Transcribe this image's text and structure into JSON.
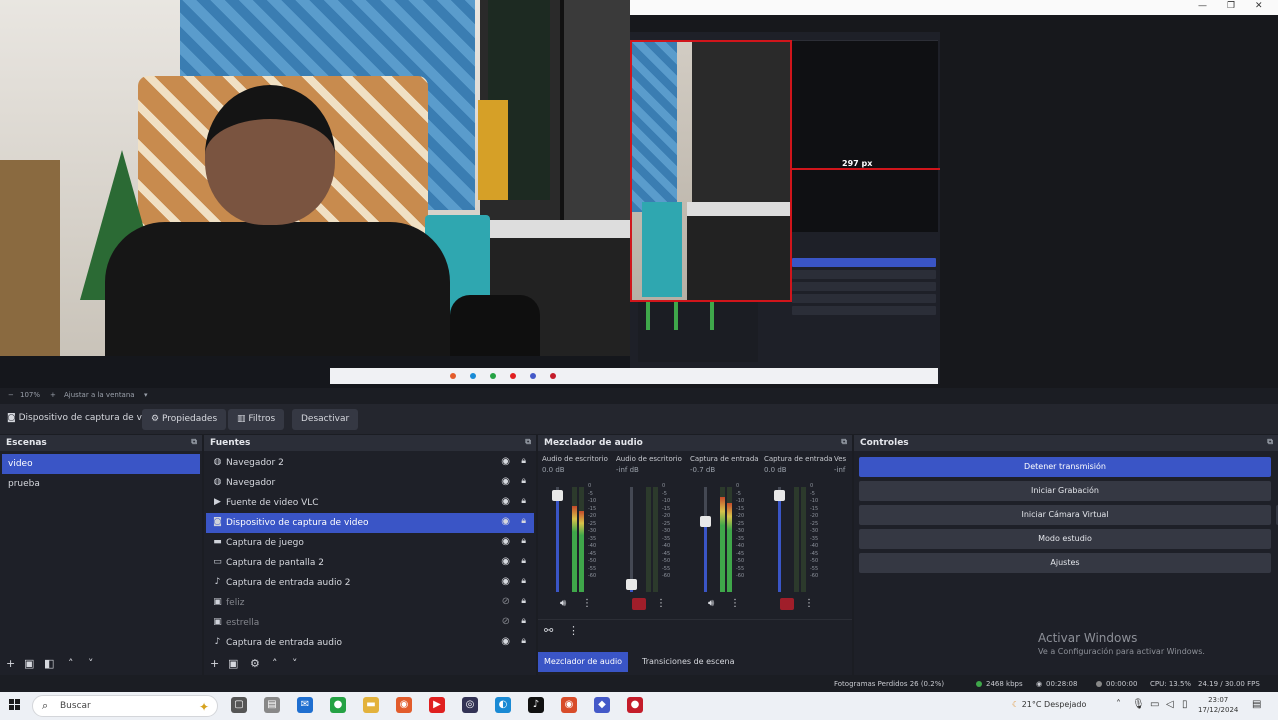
{
  "preview": {
    "measure_label": "297 px"
  },
  "zoom_bar": {
    "minus": "−",
    "zoom": "107%",
    "plus": "+",
    "fit_label": "Ajustar a la ventana",
    "dropdown": "▾"
  },
  "context_bar": {
    "source_name": "Dispositivo de captura de v",
    "properties_label": "Propiedades",
    "filters_label": "Filtros",
    "deactivate_label": "Desactivar"
  },
  "scenes": {
    "title": "Escenas",
    "items": [
      {
        "label": "video",
        "selected": true
      },
      {
        "label": "prueba",
        "selected": false
      }
    ]
  },
  "sources": {
    "title": "Fuentes",
    "items": [
      {
        "icon": "globe-icon",
        "glyph": "◍",
        "label": "Navegador 2",
        "selected": false,
        "hidden": false
      },
      {
        "icon": "globe-icon",
        "glyph": "◍",
        "label": "Navegador",
        "selected": false,
        "hidden": false
      },
      {
        "icon": "play-icon",
        "glyph": "▶",
        "label": "Fuente de video VLC",
        "selected": false,
        "hidden": false
      },
      {
        "icon": "camera-icon",
        "glyph": "◙",
        "label": "Dispositivo de captura de video",
        "selected": true,
        "hidden": false
      },
      {
        "icon": "gamepad-icon",
        "glyph": "▬",
        "label": "Captura de juego",
        "selected": false,
        "hidden": false
      },
      {
        "icon": "monitor-icon",
        "glyph": "▭",
        "label": "Captura de pantalla 2",
        "selected": false,
        "hidden": false
      },
      {
        "icon": "mic-icon",
        "glyph": "♪",
        "label": "Captura de entrada audio 2",
        "selected": false,
        "hidden": false
      },
      {
        "icon": "image-icon",
        "glyph": "▣",
        "label": "feliz",
        "selected": false,
        "hidden": true
      },
      {
        "icon": "image-icon",
        "glyph": "▣",
        "label": "estrella",
        "selected": false,
        "hidden": true
      },
      {
        "icon": "mic-icon",
        "glyph": "♪",
        "label": "Captura de entrada audio",
        "selected": false,
        "hidden": false
      }
    ]
  },
  "mixer": {
    "title": "Mezclador de audio",
    "channels": [
      {
        "name": "Audio de escritorio",
        "db": "0.0 dB",
        "volume": 0.92,
        "level": 0.82,
        "muted": false,
        "meter_color": "#3fa74a"
      },
      {
        "name": "Audio de escritorio",
        "db": "-inf dB",
        "volume": 0.08,
        "level": 0.0,
        "muted": true,
        "meter_color": "#3fa74a"
      },
      {
        "name": "Captura de entrada",
        "db": "-0.7 dB",
        "volume": 0.68,
        "level": 0.9,
        "muted": false,
        "meter_color": "#3fa74a"
      },
      {
        "name": "Captura de entrada",
        "db": "0.0 dB",
        "volume": 0.92,
        "level": 0.0,
        "muted": true,
        "meter_color": "#3fa74a"
      }
    ],
    "partial_channel": {
      "name": "Ves",
      "db": "-inf"
    },
    "scale": [
      "0",
      "-5",
      "-10",
      "-15",
      "-20",
      "-25",
      "-30",
      "-35",
      "-40",
      "-45",
      "-50",
      "-55",
      "-60"
    ],
    "tabs": [
      "Mezclador de audio",
      "Transiciones de escena"
    ]
  },
  "controls": {
    "title": "Controles",
    "buttons": [
      {
        "label": "Detener transmisión",
        "primary": true
      },
      {
        "label": "Iniciar Grabación",
        "primary": false
      },
      {
        "label": "Iniciar Cámara Virtual",
        "primary": false
      },
      {
        "label": "Modo estudio",
        "primary": false
      },
      {
        "label": "Ajustes",
        "primary": false
      }
    ],
    "activate_title": "Activar Windows",
    "activate_sub": "Ve a Configuración para activar Windows."
  },
  "status_bar": {
    "dropped_frames": "Fotogramas Perdidos 26 (0.2%)",
    "bitrate": "2468 kbps",
    "stream_time": "00:28:08",
    "rec_time": "00:00:00",
    "cpu": "CPU: 13.5%",
    "fps": "24.19 / 30.00 FPS",
    "colors": {
      "stream": "#3fa74a",
      "rec": "#888888"
    }
  },
  "taskbar": {
    "search_placeholder": "Buscar",
    "weather": "21°C Despejado",
    "time": "23:07",
    "date": "17/12/2024",
    "apps": [
      {
        "name": "task-view-icon",
        "glyph": "▢",
        "color": "#555555"
      },
      {
        "name": "files-icon",
        "glyph": "▤",
        "color": "#888888"
      },
      {
        "name": "mail-icon",
        "glyph": "✉",
        "color": "#1f6fd0"
      },
      {
        "name": "whatsapp-icon",
        "glyph": "●",
        "color": "#25a244"
      },
      {
        "name": "folder-icon",
        "glyph": "▬",
        "color": "#e3b23c"
      },
      {
        "name": "chrome-icon",
        "glyph": "◉",
        "color": "#e25c2c"
      },
      {
        "name": "youtube-icon",
        "glyph": "▶",
        "color": "#e02020"
      },
      {
        "name": "obs-icon",
        "glyph": "◎",
        "color": "#333355"
      },
      {
        "name": "edge-icon",
        "glyph": "◐",
        "color": "#1a8ad4"
      },
      {
        "name": "tiktok-icon",
        "glyph": "♪",
        "color": "#111111"
      },
      {
        "name": "chrome-icon-2",
        "glyph": "◉",
        "color": "#d84c2a"
      },
      {
        "name": "app-icon",
        "glyph": "◆",
        "color": "#4459c8"
      },
      {
        "name": "red-app-icon",
        "glyph": "●",
        "color": "#c41c2a"
      }
    ]
  }
}
